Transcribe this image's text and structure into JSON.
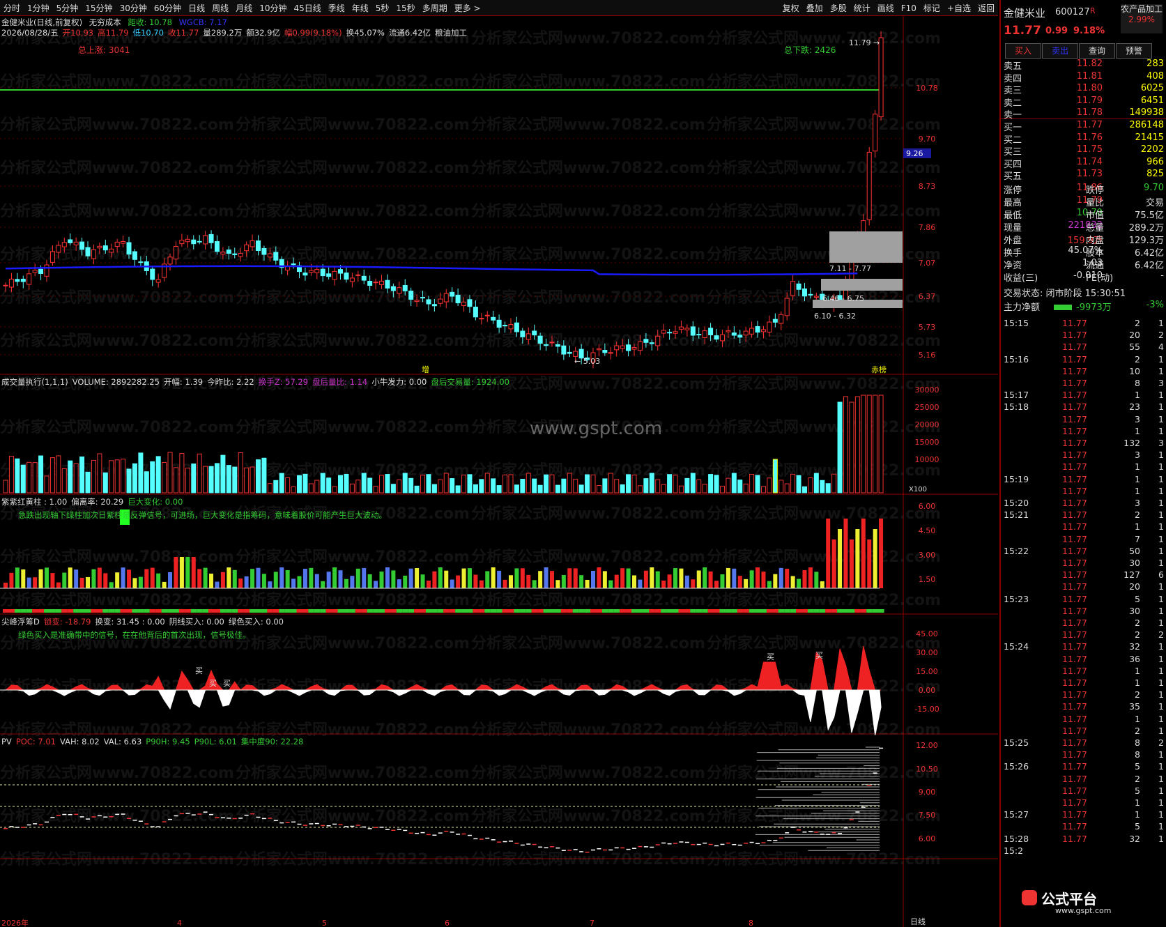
{
  "toolbar": {
    "periods": [
      "分时",
      "1分钟",
      "5分钟",
      "15分钟",
      "30分钟",
      "60分钟",
      "日线",
      "周线",
      "月线",
      "10分钟",
      "45日线",
      "季线",
      "年线",
      "5秒",
      "15秒",
      "多周期",
      "更多 >"
    ],
    "tools": [
      "复权",
      "叠加",
      "多股",
      "统计",
      "画线",
      "F10",
      "标记",
      "+自选",
      "返回"
    ]
  },
  "main": {
    "title": "金健米业(日线,前复权)",
    "indicator_name": "无穷成本",
    "dist_label": "距收: 10.78",
    "wgcb_label": "WGCB: 7.17",
    "ohlc_line": [
      "2026/08/28/五",
      "开10.93",
      "高11.79",
      "低10.70",
      "收11.77",
      "量289.2万",
      "额32.9亿",
      "幅0.99(9.18%)",
      "换45.07%",
      "流通6.42亿",
      "粮油加工"
    ],
    "total_up": "总上涨: 3041",
    "total_down": "总下跌: 2426",
    "price_axis": [
      "10.78",
      "9.70",
      "8.73",
      "7.86",
      "7.07",
      "6.37",
      "5.73",
      "5.16"
    ],
    "price_tag": "9.26",
    "high_mark": "11.79",
    "low_mark": "5.03",
    "zone1": "7.11 - 7.77",
    "zone2": "6.46 - 6.75",
    "zone3": "6.10 - 6.32",
    "tag_zeng": "增",
    "tag_chimo": "赤榜"
  },
  "volume": {
    "title": [
      "成交量执行(1,1,1)",
      "VOLUME: 2892282.25",
      "开幅: 1.39",
      "今昨比: 2.22",
      "换手Z: 57.29",
      "盘后量比: 1.14",
      "小牛发力: 0.00",
      "盘后交易量: 1924.00"
    ],
    "axis": [
      "30000",
      "25000",
      "20000",
      "15000",
      "10000"
    ],
    "unit": "X100",
    "watermark": "www.gspt.com"
  },
  "purple": {
    "title": [
      "紫紫红黄柱 : 1.00",
      "偏离率: 20.29",
      "巨大变化: 0.00"
    ],
    "note": "急跌出现轴下绿柱加次日紫柱是反弹信号，可进场，巨大变化是指筹码，意味着股价可能产生巨大波动。",
    "axis": [
      "6.00",
      "4.50",
      "3.00",
      "1.50"
    ]
  },
  "peak": {
    "title": [
      "尖峰浮筹D",
      "锁变: -18.79",
      "换变: 31.45 : 0.00",
      "阴线买入: 0.00",
      "绿色买入: 0.00"
    ],
    "note": "绿色买入是准确带中的信号，在在他背后的首次出现，信号极佳。",
    "axis": [
      "45.00",
      "30.00",
      "15.00",
      "0.00",
      "-15.00"
    ],
    "buy_label": "买"
  },
  "pv": {
    "title": [
      "PV",
      "POC: 7.01",
      "VAH: 8.02",
      "VAL: 6.63",
      "P90H: 9.45",
      "P90L: 6.01",
      "集中度90: 22.28"
    ],
    "axis": [
      "12.00",
      "10.50",
      "9.00",
      "7.50",
      "6.00"
    ],
    "dates": [
      "2026年",
      "4",
      "5",
      "6",
      "7",
      "8"
    ],
    "period_tag": "日线"
  },
  "quote": {
    "name": "金健米业",
    "code": "600127",
    "r_mark": "R",
    "sector": "农产品加工",
    "sector_pct": "2.99%",
    "price": "11.77",
    "change": "0.99",
    "pct": "9.18%",
    "buttons": [
      "买入",
      "卖出",
      "查询",
      "预警"
    ],
    "asks": [
      {
        "label": "卖五",
        "price": "11.82",
        "vol": "283"
      },
      {
        "label": "卖四",
        "price": "11.81",
        "vol": "408"
      },
      {
        "label": "卖三",
        "price": "11.80",
        "vol": "6025"
      },
      {
        "label": "卖二",
        "price": "11.79",
        "vol": "6451"
      },
      {
        "label": "卖一",
        "price": "11.78",
        "vol": "149938"
      }
    ],
    "bids": [
      {
        "label": "买一",
        "price": "11.77",
        "vol": "286148"
      },
      {
        "label": "买二",
        "price": "11.76",
        "vol": "21415"
      },
      {
        "label": "买三",
        "price": "11.75",
        "vol": "2202"
      },
      {
        "label": "买四",
        "price": "11.74",
        "vol": "966"
      },
      {
        "label": "买五",
        "price": "11.73",
        "vol": "825"
      }
    ],
    "stats": [
      {
        "k1": "涨停",
        "v1": "11.86",
        "k2": "跌停",
        "v2": "9.70"
      },
      {
        "k1": "最高",
        "v1": "11.79",
        "k2": "量比",
        "v2": "交易"
      },
      {
        "k1": "最低",
        "v1": "10.70",
        "k2": "市值",
        "v2": "75.5亿"
      },
      {
        "k1": "现量",
        "v1": "221832",
        "k2": "总量",
        "v2": "289.2万"
      },
      {
        "k1": "外盘",
        "v1": "159.9万",
        "k2": "内盘",
        "v2": "129.3万"
      },
      {
        "k1": "换手",
        "v1": "45.07%",
        "k2": "股本",
        "v2": "6.42亿"
      },
      {
        "k1": "净资",
        "v1": "1.03",
        "k2": "流通",
        "v2": "6.42亿"
      },
      {
        "k1": "收益(三)",
        "v1": "-0.010",
        "k2": "PE(动)",
        "v2": "-"
      }
    ],
    "trade_status_label": "交易状态:",
    "trade_status": "闭市阶段 15:30:51",
    "net_label": "主力净额",
    "net_value": "-9973万",
    "net_pct": "-3%"
  },
  "ticks": [
    {
      "t": "15:15",
      "p": "11.77",
      "v": "2",
      "n": "1"
    },
    {
      "t": "",
      "p": "11.77",
      "v": "20",
      "n": "2"
    },
    {
      "t": "",
      "p": "11.77",
      "v": "55",
      "n": "4"
    },
    {
      "t": "15:16",
      "p": "11.77",
      "v": "2",
      "n": "1"
    },
    {
      "t": "",
      "p": "11.77",
      "v": "10",
      "n": "1"
    },
    {
      "t": "",
      "p": "11.77",
      "v": "8",
      "n": "3"
    },
    {
      "t": "15:17",
      "p": "11.77",
      "v": "1",
      "n": "1"
    },
    {
      "t": "15:18",
      "p": "11.77",
      "v": "23",
      "n": "1"
    },
    {
      "t": "",
      "p": "11.77",
      "v": "3",
      "n": "1"
    },
    {
      "t": "",
      "p": "11.77",
      "v": "1",
      "n": "1"
    },
    {
      "t": "",
      "p": "11.77",
      "v": "132",
      "n": "3"
    },
    {
      "t": "",
      "p": "11.77",
      "v": "3",
      "n": "1"
    },
    {
      "t": "",
      "p": "11.77",
      "v": "1",
      "n": "1"
    },
    {
      "t": "15:19",
      "p": "11.77",
      "v": "1",
      "n": "1"
    },
    {
      "t": "",
      "p": "11.77",
      "v": "1",
      "n": "1"
    },
    {
      "t": "15:20",
      "p": "11.77",
      "v": "3",
      "n": "1"
    },
    {
      "t": "15:21",
      "p": "11.77",
      "v": "2",
      "n": "1"
    },
    {
      "t": "",
      "p": "11.77",
      "v": "1",
      "n": "1"
    },
    {
      "t": "",
      "p": "11.77",
      "v": "7",
      "n": "1"
    },
    {
      "t": "15:22",
      "p": "11.77",
      "v": "50",
      "n": "1"
    },
    {
      "t": "",
      "p": "11.77",
      "v": "30",
      "n": "1"
    },
    {
      "t": "",
      "p": "11.77",
      "v": "127",
      "n": "6"
    },
    {
      "t": "",
      "p": "11.77",
      "v": "20",
      "n": "1"
    },
    {
      "t": "15:23",
      "p": "11.77",
      "v": "5",
      "n": "1"
    },
    {
      "t": "",
      "p": "11.77",
      "v": "30",
      "n": "1"
    },
    {
      "t": "",
      "p": "11.77",
      "v": "2",
      "n": "1"
    },
    {
      "t": "",
      "p": "11.77",
      "v": "2",
      "n": "2"
    },
    {
      "t": "15:24",
      "p": "11.77",
      "v": "32",
      "n": "1"
    },
    {
      "t": "",
      "p": "11.77",
      "v": "36",
      "n": "1"
    },
    {
      "t": "",
      "p": "11.77",
      "v": "1",
      "n": "1"
    },
    {
      "t": "",
      "p": "11.77",
      "v": "1",
      "n": "1"
    },
    {
      "t": "",
      "p": "11.77",
      "v": "2",
      "n": "1"
    },
    {
      "t": "",
      "p": "11.77",
      "v": "35",
      "n": "1"
    },
    {
      "t": "",
      "p": "11.77",
      "v": "1",
      "n": "1"
    },
    {
      "t": "",
      "p": "11.77",
      "v": "2",
      "n": "1"
    },
    {
      "t": "15:25",
      "p": "11.77",
      "v": "8",
      "n": "2"
    },
    {
      "t": "",
      "p": "11.77",
      "v": "8",
      "n": "1"
    },
    {
      "t": "15:26",
      "p": "11.77",
      "v": "5",
      "n": "1"
    },
    {
      "t": "",
      "p": "11.77",
      "v": "2",
      "n": "1"
    },
    {
      "t": "",
      "p": "11.77",
      "v": "5",
      "n": "1"
    },
    {
      "t": "",
      "p": "11.77",
      "v": "1",
      "n": "1"
    },
    {
      "t": "15:27",
      "p": "11.77",
      "v": "1",
      "n": "1"
    },
    {
      "t": "",
      "p": "11.77",
      "v": "5",
      "n": "1"
    },
    {
      "t": "15:28",
      "p": "11.77",
      "v": "32",
      "n": "1"
    },
    {
      "t": "15:2",
      "p": "",
      "v": "",
      "n": ""
    }
  ],
  "logo": {
    "brand": "公式平台",
    "url": "www.gspt.com"
  },
  "watermark_text": "分析家公式网www.70822.com",
  "colors": {
    "up": "#ff3333",
    "down": "#55ffff",
    "panel_border": "#8b0000",
    "ma": "#1a1aff",
    "ref": "#33cc33"
  }
}
